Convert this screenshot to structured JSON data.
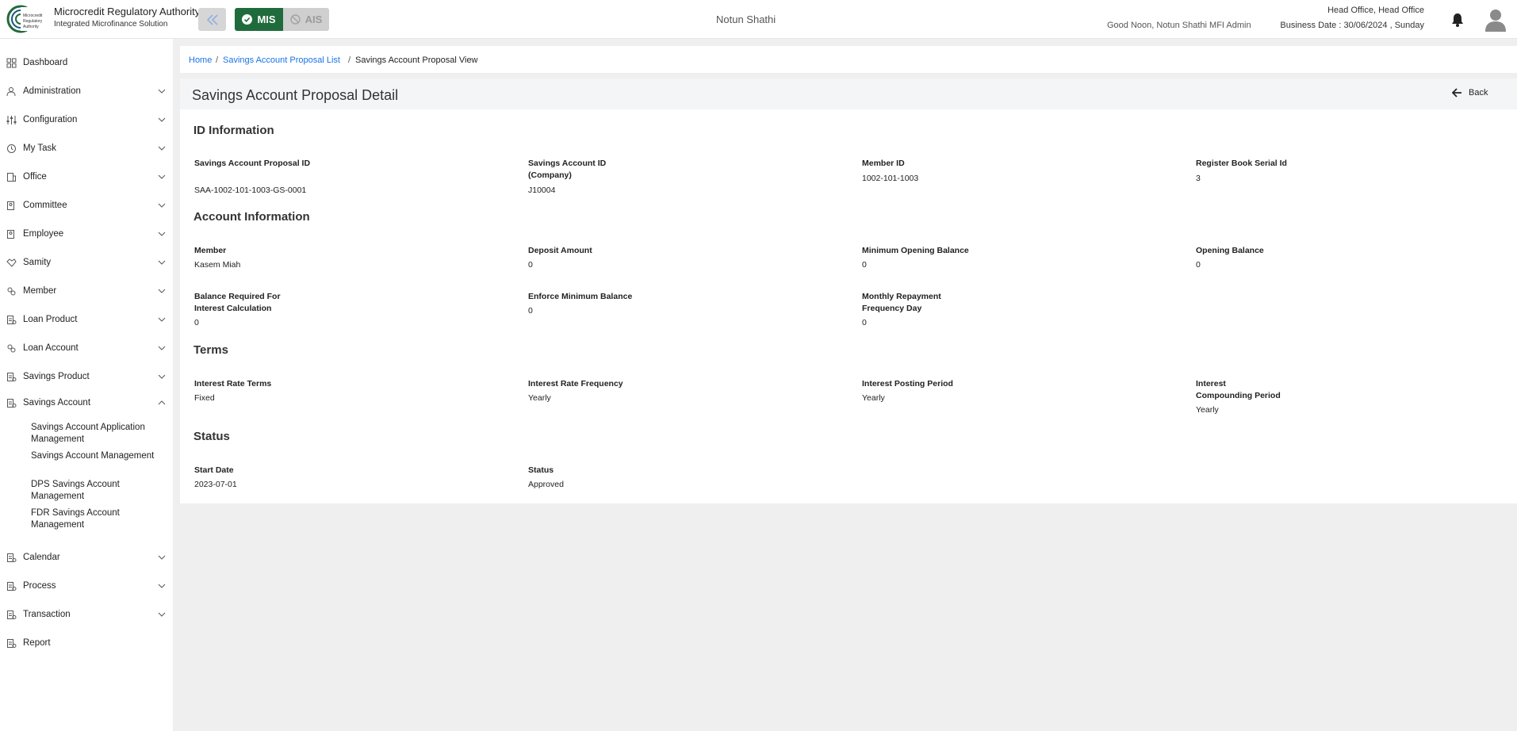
{
  "header": {
    "brand_title": "Microcredit Regulatory Authority",
    "brand_subtitle": "Integrated Microfinance Solution",
    "logo_text": "Microcredit Regulatory Authority",
    "mode_mis": "MIS",
    "mode_ais": "AIS",
    "org_name": "Notun Shathi",
    "greeting": "Good Noon, Notun Shathi MFI Admin",
    "office": "Head Office, Head Office",
    "business_date": "Business Date : 30/06/2024 , Sunday",
    "accent_color": "#1f6b3c"
  },
  "sidebar": {
    "items": [
      {
        "label": "Dashboard",
        "icon": "grid-icon"
      },
      {
        "label": "Administration",
        "icon": "admin-icon"
      },
      {
        "label": "Configuration",
        "icon": "sliders-icon"
      },
      {
        "label": "My Task",
        "icon": "task-icon"
      },
      {
        "label": "Office",
        "icon": "building-icon"
      },
      {
        "label": "Committee",
        "icon": "committee-icon"
      },
      {
        "label": "Employee",
        "icon": "employee-icon"
      },
      {
        "label": "Samity",
        "icon": "handshake-icon"
      },
      {
        "label": "Member",
        "icon": "members-icon"
      },
      {
        "label": "Loan Product",
        "icon": "document-icon"
      },
      {
        "label": "Loan Account",
        "icon": "members-icon"
      },
      {
        "label": "Savings Product",
        "icon": "document-icon"
      },
      {
        "label": "Savings Account",
        "icon": "document-icon"
      },
      {
        "label": "Calendar",
        "icon": "document-icon"
      },
      {
        "label": "Process",
        "icon": "document-icon"
      },
      {
        "label": "Transaction",
        "icon": "document-icon"
      },
      {
        "label": "Report",
        "icon": "document-icon"
      }
    ],
    "savings_sub": [
      "Savings Account Application Management",
      "Savings Account Management",
      "DPS Savings Account Management",
      "FDR Savings Account Management"
    ]
  },
  "breadcrumb": {
    "home": "Home",
    "list": "Savings Account Proposal List",
    "current": "Savings Account Proposal View",
    "sep": "/"
  },
  "panel": {
    "title": "Savings Account Proposal Detail",
    "back_label": "Back"
  },
  "sections": {
    "id_info": {
      "title": "ID Information",
      "fields": [
        {
          "label": "Savings Account Proposal ID",
          "value": "SAA-1002-101-1003-GS-0001"
        },
        {
          "label": "Savings Account ID (Company)",
          "value": "J10004"
        },
        {
          "label": "Member ID",
          "value": "1002-101-1003"
        },
        {
          "label": "Register Book Serial Id",
          "value": "3"
        }
      ]
    },
    "account_info": {
      "title": "Account Information",
      "fields": [
        {
          "label": "Member",
          "value": "Kasem Miah"
        },
        {
          "label": "Deposit Amount",
          "value": "0"
        },
        {
          "label": "Minimum Opening Balance",
          "value": "0"
        },
        {
          "label": "Opening Balance",
          "value": "0"
        },
        {
          "label": "Balance Required For Interest Calculation",
          "value": "0"
        },
        {
          "label": "Enforce Minimum Balance",
          "value": "0"
        },
        {
          "label": "Monthly Repayment Frequency Day",
          "value": "0"
        }
      ]
    },
    "terms": {
      "title": "Terms",
      "fields": [
        {
          "label": "Interest Rate Terms",
          "value": "Fixed"
        },
        {
          "label": "Interest Rate Frequency",
          "value": "Yearly"
        },
        {
          "label": "Interest Posting Period",
          "value": "Yearly"
        },
        {
          "label": "Interest Compounding Period",
          "value": "Yearly"
        }
      ]
    },
    "status": {
      "title": "Status",
      "fields": [
        {
          "label": "Start Date",
          "value": "2023-07-01"
        },
        {
          "label": "Status",
          "value": "Approved"
        }
      ]
    }
  }
}
